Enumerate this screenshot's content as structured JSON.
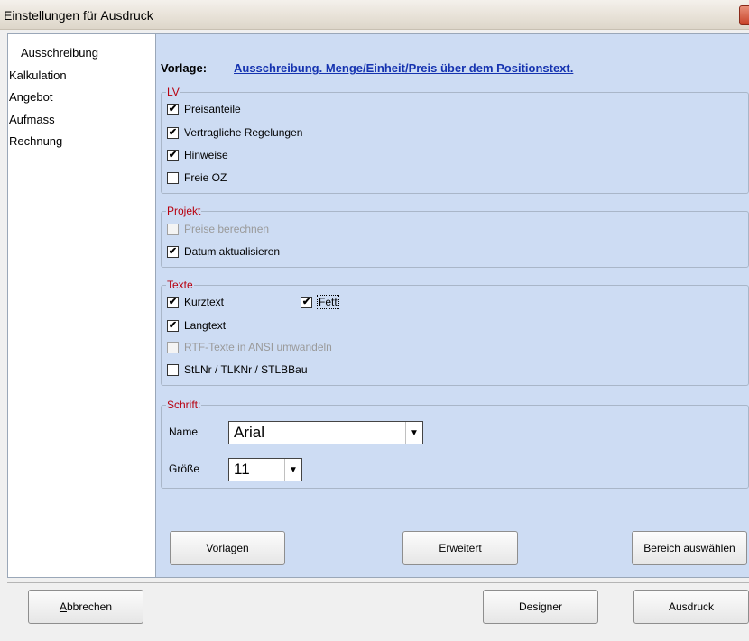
{
  "window": {
    "title": "Einstellungen für Ausdruck"
  },
  "nav": {
    "items": [
      "Ausschreibung",
      "Kalkulation",
      "Angebot",
      "Aufmass",
      "Rechnung"
    ]
  },
  "vorlage": {
    "label": "Vorlage:",
    "link": "Ausschreibung. Menge/Einheit/Preis über dem Positionstext."
  },
  "groups": {
    "lv": {
      "title": "LV",
      "options": [
        {
          "label": "Preisanteile",
          "checked": true
        },
        {
          "label": "Vertragliche Regelungen",
          "checked": true
        },
        {
          "label": "Hinweise",
          "checked": true
        },
        {
          "label": "Freie OZ",
          "checked": false
        }
      ]
    },
    "projekt": {
      "title": "Projekt",
      "options": [
        {
          "label": "Preise berechnen",
          "checked": false,
          "disabled": true
        },
        {
          "label": "Datum aktualisieren",
          "checked": true
        }
      ]
    },
    "texte": {
      "title": "Texte",
      "options": [
        {
          "label": "Kurztext",
          "checked": true
        },
        {
          "label": "Fett",
          "checked": true
        },
        {
          "label": "Langtext",
          "checked": true
        },
        {
          "label": "RTF-Texte in ANSI umwandeln",
          "checked": false,
          "disabled": true
        },
        {
          "label": "StLNr / TLKNr / STLBBau",
          "checked": false
        }
      ]
    },
    "schrift": {
      "title": "Schrift:",
      "name_label": "Name",
      "name_value": "Arial",
      "size_label": "Größe",
      "size_value": "11"
    }
  },
  "buttons": {
    "vorlagen": "Vorlagen",
    "erweitert": "Erweitert",
    "bereich": "Bereich auswählen",
    "abbrechen_mnemonic": "A",
    "abbrechen_rest": "bbrechen",
    "designer": "Designer",
    "ausdruck": "Ausdruck"
  },
  "icons": {
    "check": "✔",
    "dropdown": "▼"
  }
}
